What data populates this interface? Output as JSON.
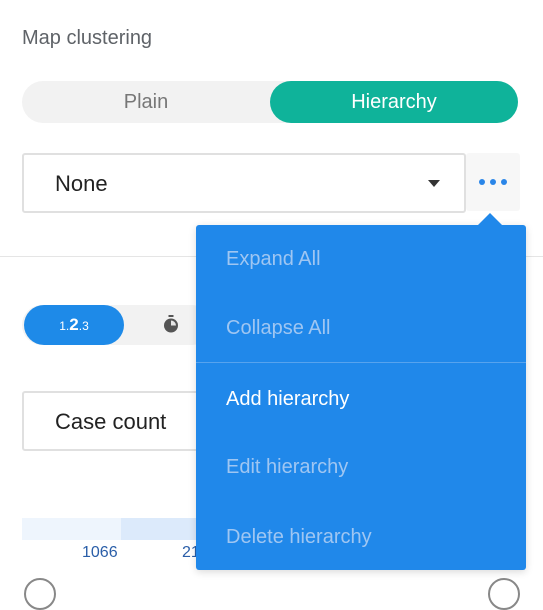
{
  "section": {
    "title": "Map clustering"
  },
  "clustering_mode": {
    "options": [
      {
        "label": "Plain",
        "selected": false
      },
      {
        "label": "Hierarchy",
        "selected": true
      }
    ]
  },
  "hierarchy_select": {
    "value": "None"
  },
  "more_button": {
    "icon": "more-dots-icon"
  },
  "display_mode": {
    "number_label_parts": [
      "1.",
      "2",
      ".3"
    ],
    "timer_icon": "timer-icon"
  },
  "metric_select": {
    "value": "Case count"
  },
  "legend": {
    "labels": [
      "1066",
      "21"
    ]
  },
  "menu": {
    "items": [
      {
        "label": "Expand All",
        "enabled": false
      },
      {
        "label": "Collapse All",
        "enabled": false
      },
      {
        "label": "Add hierarchy",
        "enabled": true
      },
      {
        "label": "Edit hierarchy",
        "enabled": false
      },
      {
        "label": "Delete hierarchy",
        "enabled": false
      }
    ]
  },
  "colors": {
    "accent_teal": "#0fb39a",
    "accent_blue": "#2088ea",
    "menu_disabled_text": "#9fc6f2"
  }
}
